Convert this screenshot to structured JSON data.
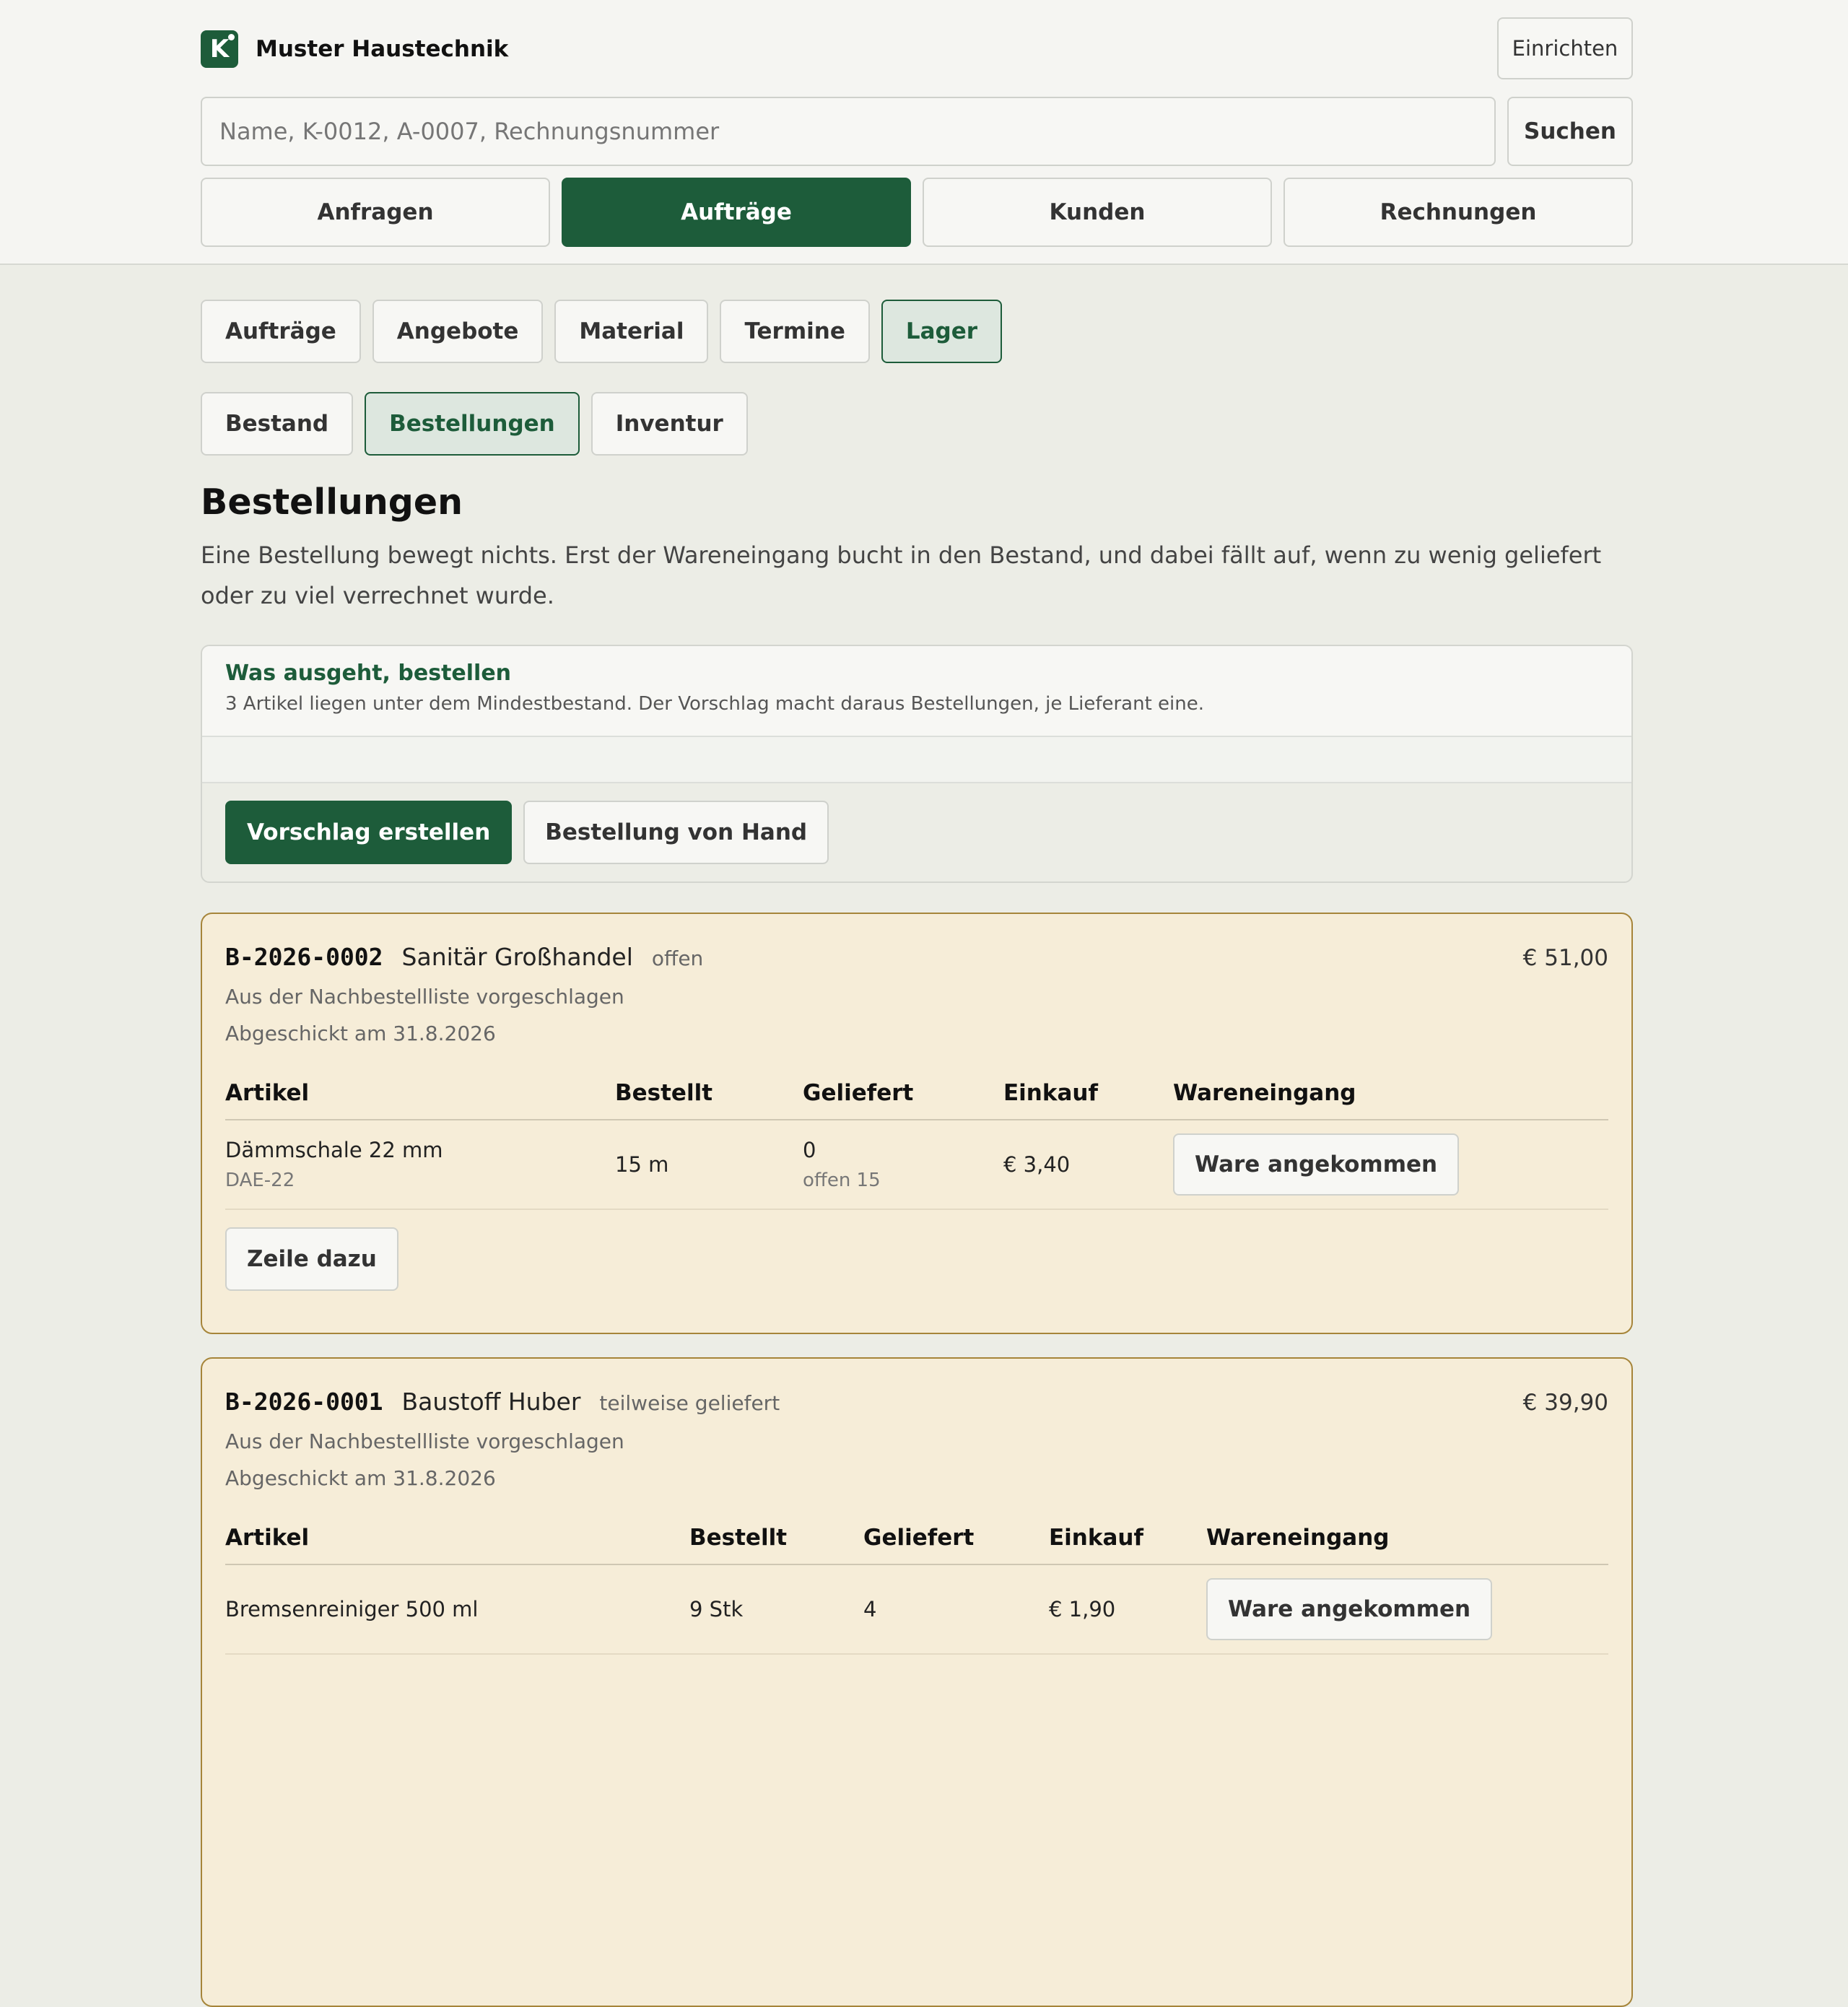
{
  "header": {
    "brand_name": "Muster Haustechnik",
    "setup_label": "Einrichten",
    "search_placeholder": "Name, K-0012, A-0007, Rechnungsnummer",
    "search_button": "Suchen",
    "main_tabs": [
      {
        "label": "Anfragen",
        "active": false
      },
      {
        "label": "Aufträge",
        "active": true
      },
      {
        "label": "Kunden",
        "active": false
      },
      {
        "label": "Rechnungen",
        "active": false
      }
    ]
  },
  "section_tabs": [
    {
      "label": "Aufträge",
      "active": false
    },
    {
      "label": "Angebote",
      "active": false
    },
    {
      "label": "Material",
      "active": false
    },
    {
      "label": "Termine",
      "active": false
    },
    {
      "label": "Lager",
      "active": true
    }
  ],
  "sub_tabs": [
    {
      "label": "Bestand",
      "active": false
    },
    {
      "label": "Bestellungen",
      "active": true
    },
    {
      "label": "Inventur",
      "active": false
    }
  ],
  "page": {
    "title": "Bestellungen",
    "intro": "Eine Bestellung bewegt nichts. Erst der Wareneingang bucht in den Bestand, und dabei fällt auf, wenn zu wenig geliefert oder zu viel verrechnet wurde."
  },
  "suggest": {
    "title": "Was ausgeht, bestellen",
    "subtitle": "3 Artikel liegen unter dem Mindestbestand. Der Vorschlag macht daraus Bestellungen, je Lieferant eine.",
    "primary_button": "Vorschlag erstellen",
    "secondary_button": "Bestellung von Hand"
  },
  "table_headers": {
    "article": "Artikel",
    "ordered": "Bestellt",
    "delivered": "Geliefert",
    "purchase": "Einkauf",
    "receipt": "Wareneingang"
  },
  "orders": [
    {
      "id": "B-2026-0002",
      "supplier": "Sanitär Großhandel",
      "status": "offen",
      "total": "€ 51,00",
      "source": "Aus der Nachbestellliste vorgeschlagen",
      "sent": "Abgeschickt am 31.8.2026",
      "items": [
        {
          "name": "Dämmschale 22 mm",
          "sku": "DAE-22",
          "ordered": "15 m",
          "delivered": "0",
          "open": "offen 15",
          "price": "€ 3,40",
          "action": "Ware angekommen"
        }
      ],
      "add_line": "Zeile dazu"
    },
    {
      "id": "B-2026-0001",
      "supplier": "Baustoff Huber",
      "status": "teilweise geliefert",
      "total": "€ 39,90",
      "source": "Aus der Nachbestellliste vorgeschlagen",
      "sent": "Abgeschickt am 31.8.2026",
      "items": [
        {
          "name": "Bremsenreiniger 500 ml",
          "ordered": "9 Stk",
          "delivered": "4",
          "price": "€ 1,90",
          "action": "Ware angekommen"
        }
      ]
    }
  ],
  "colors": {
    "brand_green": "#1d5c3a",
    "card_background": "#f6edd8",
    "card_border": "#a6853a",
    "page_background": "#ecede6"
  }
}
